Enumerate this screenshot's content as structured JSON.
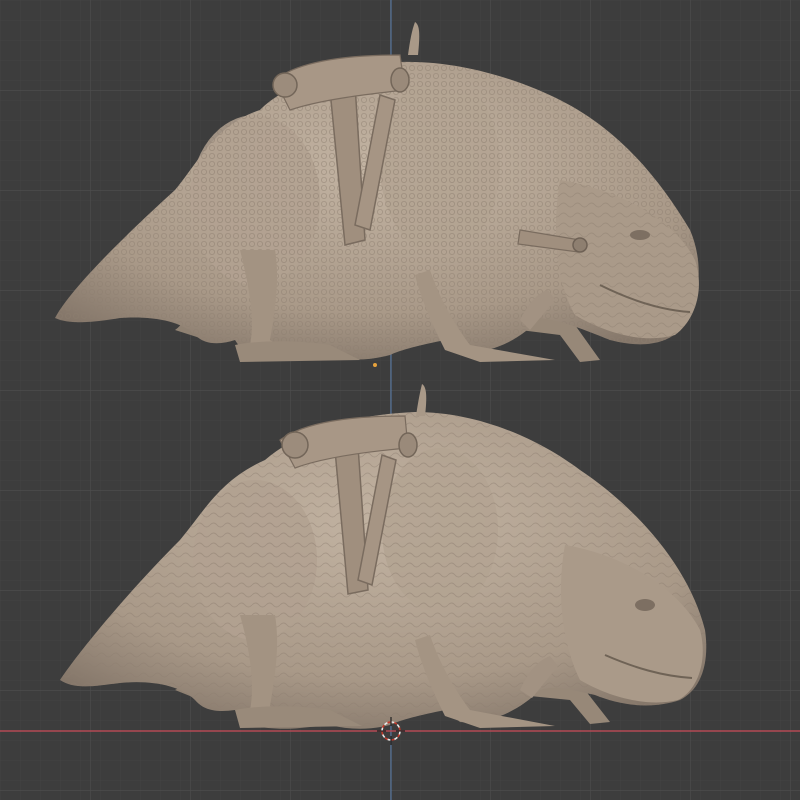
{
  "app": "3D viewport",
  "viewport": {
    "background_color": "#3d3d3d",
    "grid_minor_color": "#444444",
    "grid_major_color": "#4d4d4d",
    "x_axis_color": "#b44a55",
    "y_axis_color": "#5a7fb0",
    "show_grid": true,
    "show_axes": true
  },
  "objects": [
    {
      "kind": "sculpt",
      "subject": "creature",
      "state": "detailed"
    },
    {
      "kind": "sculpt",
      "subject": "creature",
      "state": "smoothed"
    }
  ],
  "material_color": "#a99988",
  "cursor_3d_icon": "3d-cursor-icon",
  "origin_icon": "origin-dot-icon"
}
